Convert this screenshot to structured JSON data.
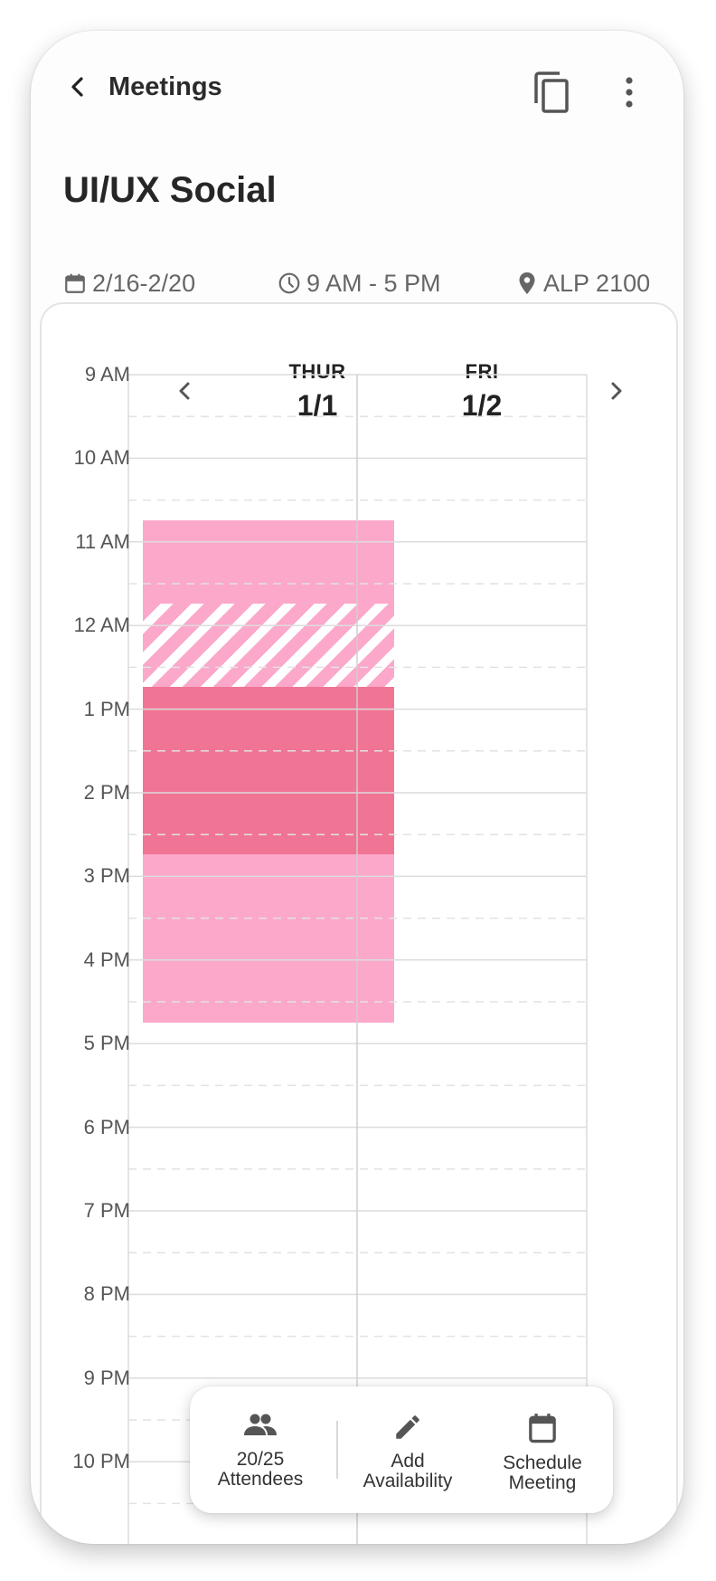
{
  "header": {
    "title": "Meetings"
  },
  "event": {
    "title": "UI/UX Social",
    "date_range": "2/16-2/20",
    "time_range": "9 AM - 5 PM",
    "location": "ALP 2100"
  },
  "calendar": {
    "days": [
      {
        "name": "THUR",
        "date": "1/1"
      },
      {
        "name": "FRI",
        "date": "1/2"
      }
    ],
    "hour_labels": [
      "9 AM",
      "10 AM",
      "11 AM",
      "12 AM",
      "1 PM",
      "2 PM",
      "3 PM",
      "4 PM",
      "5 PM",
      "6 PM",
      "7 PM",
      "8 PM",
      "9 PM",
      "10 PM"
    ],
    "availability_colors": {
      "light": "#fba8cb",
      "dark": "#f07494"
    }
  },
  "actions": {
    "attendees": {
      "count": "20/25",
      "label": "Attendees"
    },
    "add_availability": {
      "line1": "Add",
      "line2": "Availability"
    },
    "schedule_meeting": {
      "line1": "Schedule",
      "line2": "Meeting"
    }
  }
}
